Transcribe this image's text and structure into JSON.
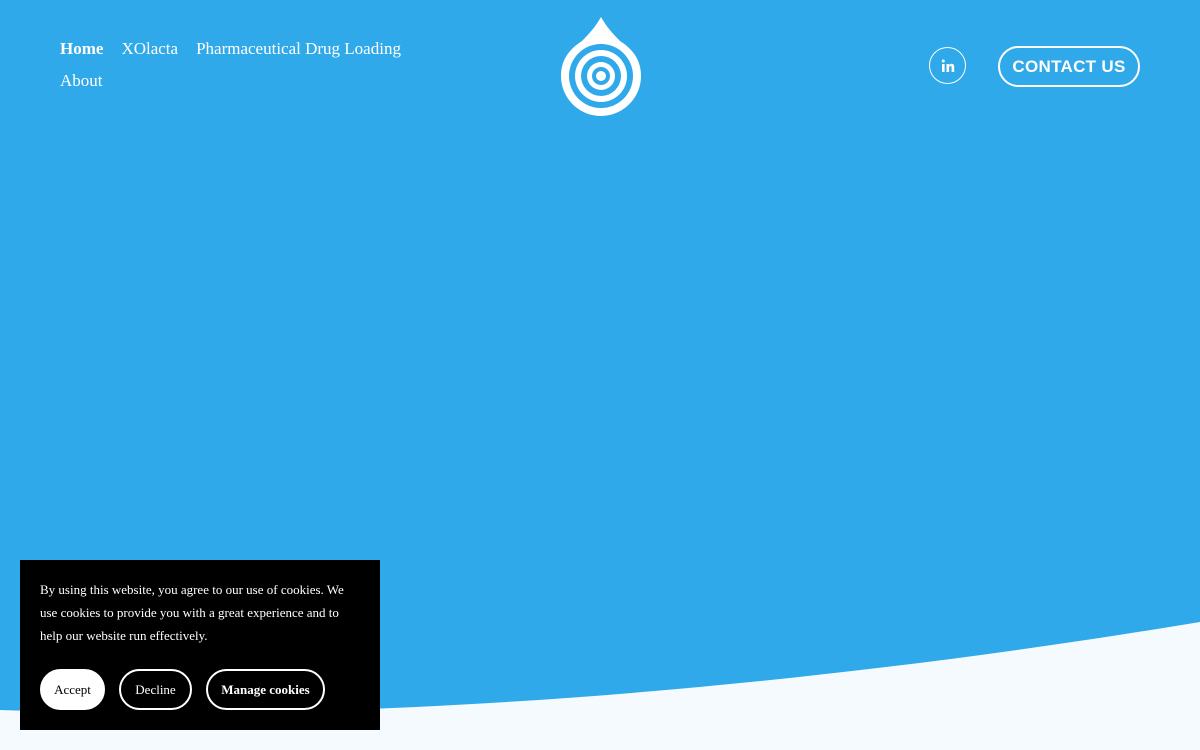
{
  "nav": {
    "items": [
      {
        "label": "Home",
        "active": true
      },
      {
        "label": "XOlacta",
        "active": false
      },
      {
        "label": "Pharmaceutical Drug Loading",
        "active": false
      },
      {
        "label": "About",
        "active": false
      }
    ]
  },
  "logo": {
    "icon": "water-drop-target-logo"
  },
  "social": {
    "icon": "linkedin-icon",
    "glyph": "in"
  },
  "contact_button": {
    "label": "CONTACT US"
  },
  "cookie_banner": {
    "text": "By using this website, you agree to our use of cookies. We use cookies to provide you with a great experience and to help our website run effectively.",
    "accept_label": "Accept",
    "decline_label": "Decline",
    "manage_label": "Manage cookies"
  },
  "colors": {
    "background": "#2fa9e9",
    "wave": "#f4fafe",
    "banner": "#000000",
    "text": "#ffffff"
  }
}
